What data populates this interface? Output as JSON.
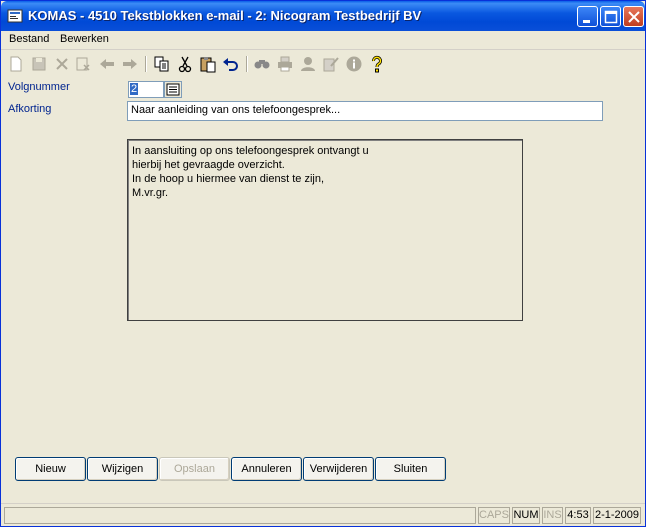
{
  "window": {
    "title": "KOMAS - 4510 Tekstblokken e-mail - 2: Nicogram Testbedrijf BV"
  },
  "menubar": {
    "items": [
      {
        "label": "Bestand"
      },
      {
        "label": "Bewerken"
      }
    ]
  },
  "toolbar": {
    "icons": [
      "new-icon",
      "save-icon",
      "delete-icon",
      "cancel-edit-icon",
      "back-arrow-icon",
      "forward-arrow-icon",
      "copy-icon",
      "cut-icon",
      "paste-icon",
      "undo-icon",
      "find-icon",
      "print-icon",
      "user-icon",
      "notes-icon",
      "info-icon",
      "help-icon"
    ]
  },
  "form": {
    "volgnummer_label": "Volgnummer",
    "volgnummer_value": "2",
    "afkorting_label": "Afkorting",
    "afkorting_value": "Naar aanleiding van ons telefoongesprek...",
    "memo_lines": [
      "In aansluiting op ons telefoongesprek ontvangt u",
      "hierbij het gevraagde overzicht.",
      "",
      "In de hoop u hiermee van dienst te zijn,",
      "",
      "M.vr.gr."
    ]
  },
  "buttons": {
    "nieuw": "Nieuw",
    "wijzigen": "Wijzigen",
    "opslaan": "Opslaan",
    "annuleren": "Annuleren",
    "verwijderen": "Verwijderen",
    "sluiten": "Sluiten"
  },
  "status": {
    "caps": "CAPS",
    "num": "NUM",
    "ins": "INS",
    "time": "4:53",
    "date": "2-1-2009"
  }
}
